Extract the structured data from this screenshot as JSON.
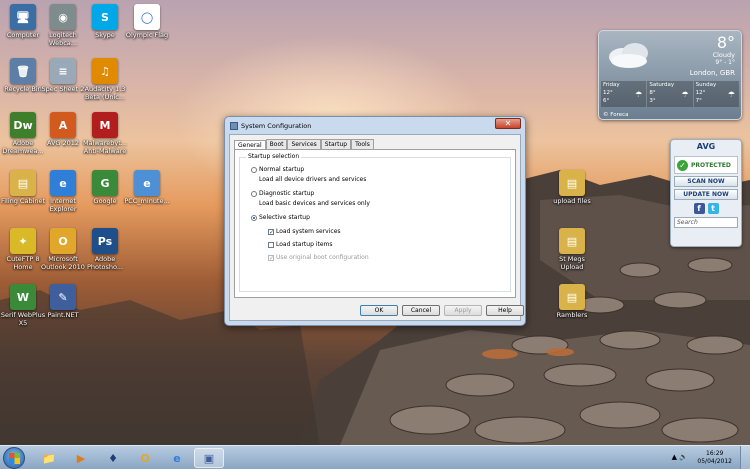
{
  "desktop": {
    "icons": [
      {
        "label": "Computer",
        "glyph": "🖥",
        "color": "#3a6ea5"
      },
      {
        "label": "Logitech\nWebca...",
        "glyph": "◉",
        "color": "#7f8c8d"
      },
      {
        "label": "Skype",
        "glyph": "S",
        "color": "#00a8e8"
      },
      {
        "label": "Olympic Flag",
        "glyph": "◯",
        "color": "#ffffff"
      },
      {
        "label": "Recycle Bin",
        "glyph": "🗑",
        "color": "#5d7ea6"
      },
      {
        "label": "Spec Sheet 2",
        "glyph": "≡",
        "color": "#9aa9b8"
      },
      {
        "label": "Audacity 1.3\nBeta (Unic...",
        "glyph": "♫",
        "color": "#e08a00"
      },
      {
        "label": "Adobe\nDreamwea...",
        "glyph": "Dw",
        "color": "#3f7f2c"
      },
      {
        "label": "AVG 2012",
        "glyph": "A",
        "color": "#d25a1e"
      },
      {
        "label": "Malwarebyt...\nAnti-Malware",
        "glyph": "M",
        "color": "#b21e1e"
      },
      {
        "label": "Filing Cabinet",
        "glyph": "▤",
        "color": "#d9b34a"
      },
      {
        "label": "Internet\nExplorer",
        "glyph": "e",
        "color": "#2f7fd8"
      },
      {
        "label": "Google",
        "glyph": "G",
        "color": "#3b8a3b"
      },
      {
        "label": "PCC_minute...",
        "glyph": "e",
        "color": "#4d90d6"
      },
      {
        "label": "CuteFTP 8\nHome",
        "glyph": "✦",
        "color": "#d9b928"
      },
      {
        "label": "Microsoft\nOutlook 2010",
        "glyph": "O",
        "color": "#e0a72a"
      },
      {
        "label": "Adobe\nPhotosho...",
        "glyph": "Ps",
        "color": "#1f4f8a"
      },
      {
        "label": "Serif WebPlus\nX5",
        "glyph": "W",
        "color": "#3a8a3a"
      },
      {
        "label": "Paint.NET",
        "glyph": "✎",
        "color": "#3e5f9c"
      },
      {
        "label": "upload files",
        "glyph": "▤",
        "color": "#d9b34a"
      },
      {
        "label": "St Megs\nUpload",
        "glyph": "▤",
        "color": "#d9b34a"
      },
      {
        "label": "Ramblers",
        "glyph": "▤",
        "color": "#d9b34a"
      }
    ]
  },
  "dialog": {
    "title": "System Configuration",
    "close_glyph": "✕",
    "tabs": [
      "General",
      "Boot",
      "Services",
      "Startup",
      "Tools"
    ],
    "group_title": "Startup selection",
    "options": [
      {
        "label": "Normal startup",
        "desc": "Load all device drivers and services",
        "selected": false
      },
      {
        "label": "Diagnostic startup",
        "desc": "Load basic devices and services only",
        "selected": false
      },
      {
        "label": "Selective startup",
        "desc": "",
        "selected": true
      }
    ],
    "checks": [
      {
        "label": "Load system services",
        "checked": true,
        "disabled": false
      },
      {
        "label": "Load startup items",
        "checked": false,
        "disabled": false
      },
      {
        "label": "Use original boot configuration",
        "checked": true,
        "disabled": true
      }
    ],
    "buttons": {
      "ok": "OK",
      "cancel": "Cancel",
      "apply": "Apply",
      "help": "Help"
    }
  },
  "weather": {
    "temp": "8°",
    "condition": "Cloudy",
    "range": "9° - 1°",
    "location": "London, GBR",
    "days": [
      {
        "name": "Friday",
        "hi": "12°",
        "lo": "6°"
      },
      {
        "name": "Saturday",
        "hi": "8°",
        "lo": "3°"
      },
      {
        "name": "Sunday",
        "hi": "12°",
        "lo": "7°"
      }
    ],
    "footer": "© Foreca"
  },
  "avg": {
    "logo": "AVG",
    "status": "PROTECTED",
    "scan": "SCAN NOW",
    "update": "UPDATE NOW",
    "search_placeholder": "Search"
  },
  "taskbar": {
    "apps": [
      "📁",
      "▶",
      "♦",
      "O",
      "e",
      "▣"
    ],
    "tray": "▲ 🔊",
    "time": "16:29",
    "date": "05/04/2012"
  }
}
